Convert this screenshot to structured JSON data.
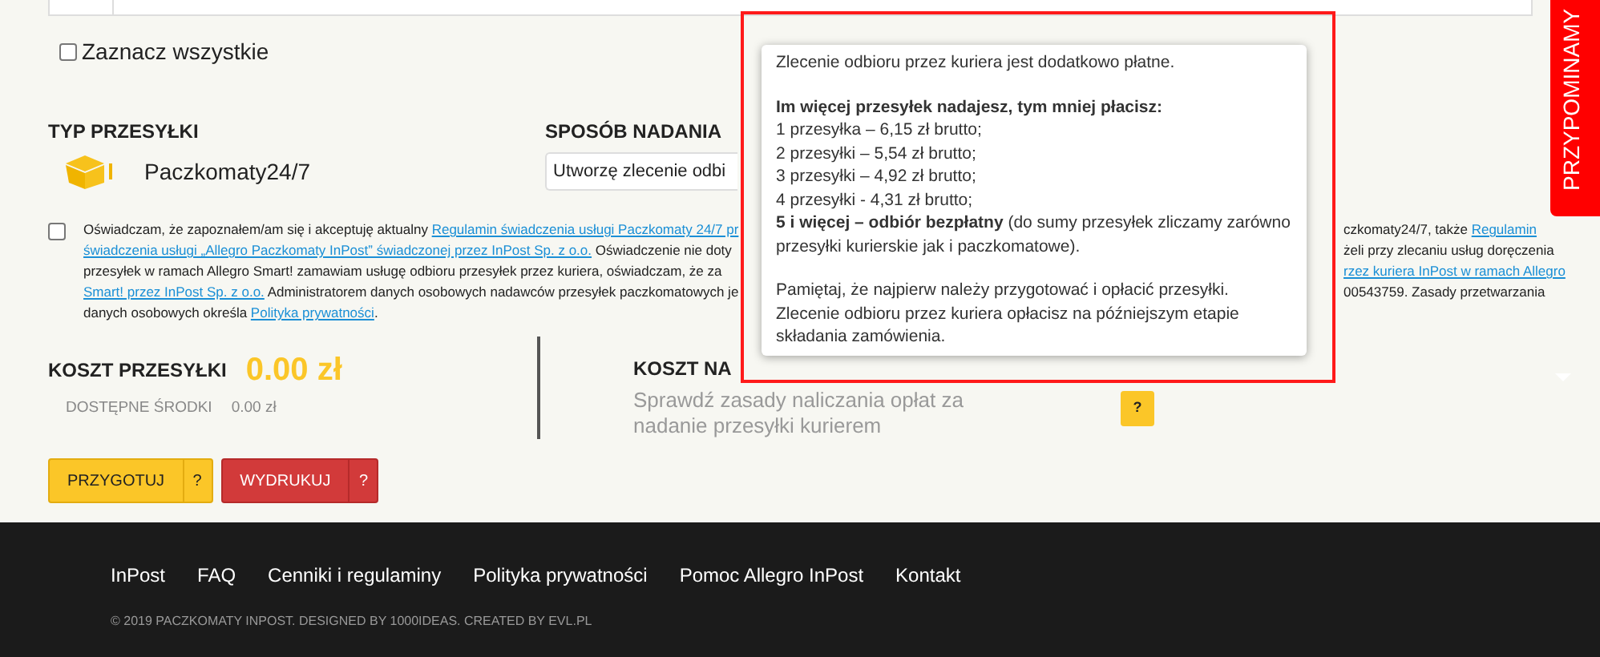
{
  "side_tab": {
    "label": "PRZYPOMINAMY"
  },
  "select_all": {
    "label": "Zaznacz wszystkie",
    "checked": false
  },
  "shipment_type": {
    "heading": "TYP PRZESYŁKI",
    "value": "Paczkomaty24/7"
  },
  "sending_method": {
    "heading": "SPOSÓB NADANIA",
    "value": "Utworzę zlecenie odbi"
  },
  "consent": {
    "checked": false,
    "lines": [
      {
        "left": [
          {
            "text": "Oświadczam, że zapoznałem/am się i akceptuję aktualny ",
            "link": false
          },
          {
            "text": "Regulamin świadczenia usługi Paczkomaty 24/7 pr",
            "link": true
          }
        ],
        "right": [
          {
            "text": "czkomaty24/7, także ",
            "link": false
          },
          {
            "text": "Regulamin",
            "link": true
          }
        ]
      },
      {
        "left": [
          {
            "text": "świadczenia usługi „Allegro Paczkomaty InPost” świadczonej przez InPost Sp. z o.o.",
            "link": true
          },
          {
            "text": " Oświadczenie nie doty",
            "link": false
          }
        ],
        "right": [
          {
            "text": "żeli przy zlecaniu usług doręczenia",
            "link": false
          }
        ]
      },
      {
        "left": [
          {
            "text": "przesyłek w ramach Allegro Smart! zamawiam usługę odbioru przesyłek przez kuriera, oświadczam, że za",
            "link": false
          }
        ],
        "right": [
          {
            "text": "rzez kuriera InPost w ramach Allegro",
            "link": true
          }
        ]
      },
      {
        "left": [
          {
            "text": "Smart! przez InPost Sp. z o.o.",
            "link": true
          },
          {
            "text": " Administratorem danych osobowych nadawców przesyłek paczkomatowych je",
            "link": false
          }
        ],
        "right": [
          {
            "text": "00543759. Zasady przetwarzania",
            "link": false
          }
        ]
      },
      {
        "left": [
          {
            "text": "danych osobowych określa ",
            "link": false
          },
          {
            "text": "Polityka prywatności",
            "link": true
          },
          {
            "text": ".",
            "link": false
          }
        ]
      }
    ]
  },
  "shipping_cost": {
    "label": "KOSZT PRZESYŁKI",
    "amount": "0.00 zł",
    "funds_label": "DOSTĘPNE ŚRODKI",
    "funds": "0.00 zł"
  },
  "courier_cost": {
    "label": "KOSZT NA",
    "hint": "Sprawdź zasady naliczania opłat za nadanie przesyłki kurierem",
    "help": "?"
  },
  "buttons": [
    {
      "label": "PRZYGOTUJ",
      "help": "?",
      "kind": "yellow"
    },
    {
      "label": "WYDRUKUJ",
      "help": "?",
      "kind": "red"
    }
  ],
  "tooltip": {
    "paragraphs": [
      [
        {
          "text": "Zlecenie odbioru przez kuriera jest dodatkowo płatne.",
          "bold": false
        }
      ],
      [
        {
          "text": "Im więcej przesyłek nadajesz, tym mniej płacisz:",
          "bold": true
        },
        {
          "text": "1 przesyłka – 6,15 zł brutto;",
          "bold": false
        },
        {
          "text": "2 przesyłki – 5,54 zł brutto;",
          "bold": false
        },
        {
          "text": "3 przesyłki – 4,92 zł brutto;",
          "bold": false
        },
        {
          "text": "4 przesyłki - 4,31 zł brutto;",
          "bold": false
        },
        {
          "text": "**5 i więcej – odbiór bezpłatny** (do sumy przesyłek zliczamy zarówno przesyłki kurierskie jak i paczkomatowe).",
          "bold": false
        }
      ],
      [
        {
          "text": "Pamiętaj, że najpierw należy przygotować i opłacić przesyłki. Zlecenie odbioru przez kuriera opłacisz na późniejszym etapie składania zamówienia.",
          "bold": false
        }
      ]
    ]
  },
  "footer": {
    "links": [
      "InPost",
      "FAQ",
      "Cenniki i regulaminy",
      "Polityka prywatności",
      "Pomoc Allegro InPost",
      "Kontakt"
    ],
    "copyright": "© 2019 PACZKOMATY INPOST. DESIGNED BY 1000IDEAS. CREATED BY EVL.PL"
  }
}
